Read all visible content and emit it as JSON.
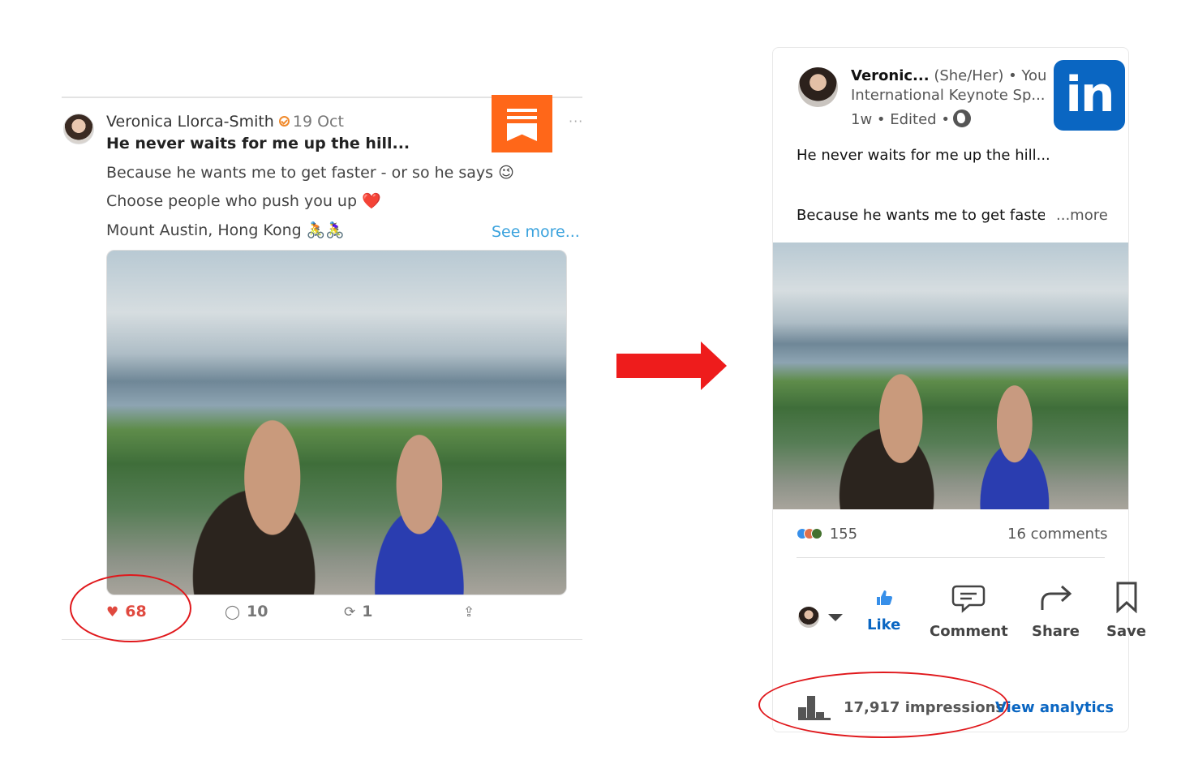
{
  "substack": {
    "author": "Veronica Llorca-Smith",
    "date": "19 Oct",
    "headline": "He never waits for me up the hill...",
    "lines": [
      "Because he wants me to get faster - or so he says 😉",
      "Choose people who push you up ❤️",
      "Mount Austin, Hong Kong 🚴🚴‍♀️"
    ],
    "see_more": "See more...",
    "more_menu": "···",
    "likes": "68",
    "comments": "10",
    "restacks": "1",
    "icons": {
      "like": "heart-icon",
      "comment": "speech-bubble-icon",
      "restack": "restack-icon",
      "share": "share-icon",
      "logo": "substack-logo-icon",
      "verified": "verified-badge-icon"
    }
  },
  "linkedin": {
    "author_short": "Veronic...",
    "pronouns": "(She/Her)",
    "relation": "• You",
    "headline": "International Keynote Sp...",
    "meta": "1w • Edited •",
    "logo_text": "in",
    "post_line1": "He never waits for me up the hill...",
    "post_line2": "Because he wants me to get faster",
    "more": "...more",
    "reaction_count": "155",
    "comments_count": "16 comments",
    "actions": {
      "like": "Like",
      "comment": "Comment",
      "share": "Share",
      "save": "Save"
    },
    "impressions": "17,917 impressions",
    "analytics": "View analytics",
    "colors": {
      "brand": "#0a66c2",
      "like_blue": "#378fe9"
    }
  },
  "annotation_color": "#e0181c"
}
